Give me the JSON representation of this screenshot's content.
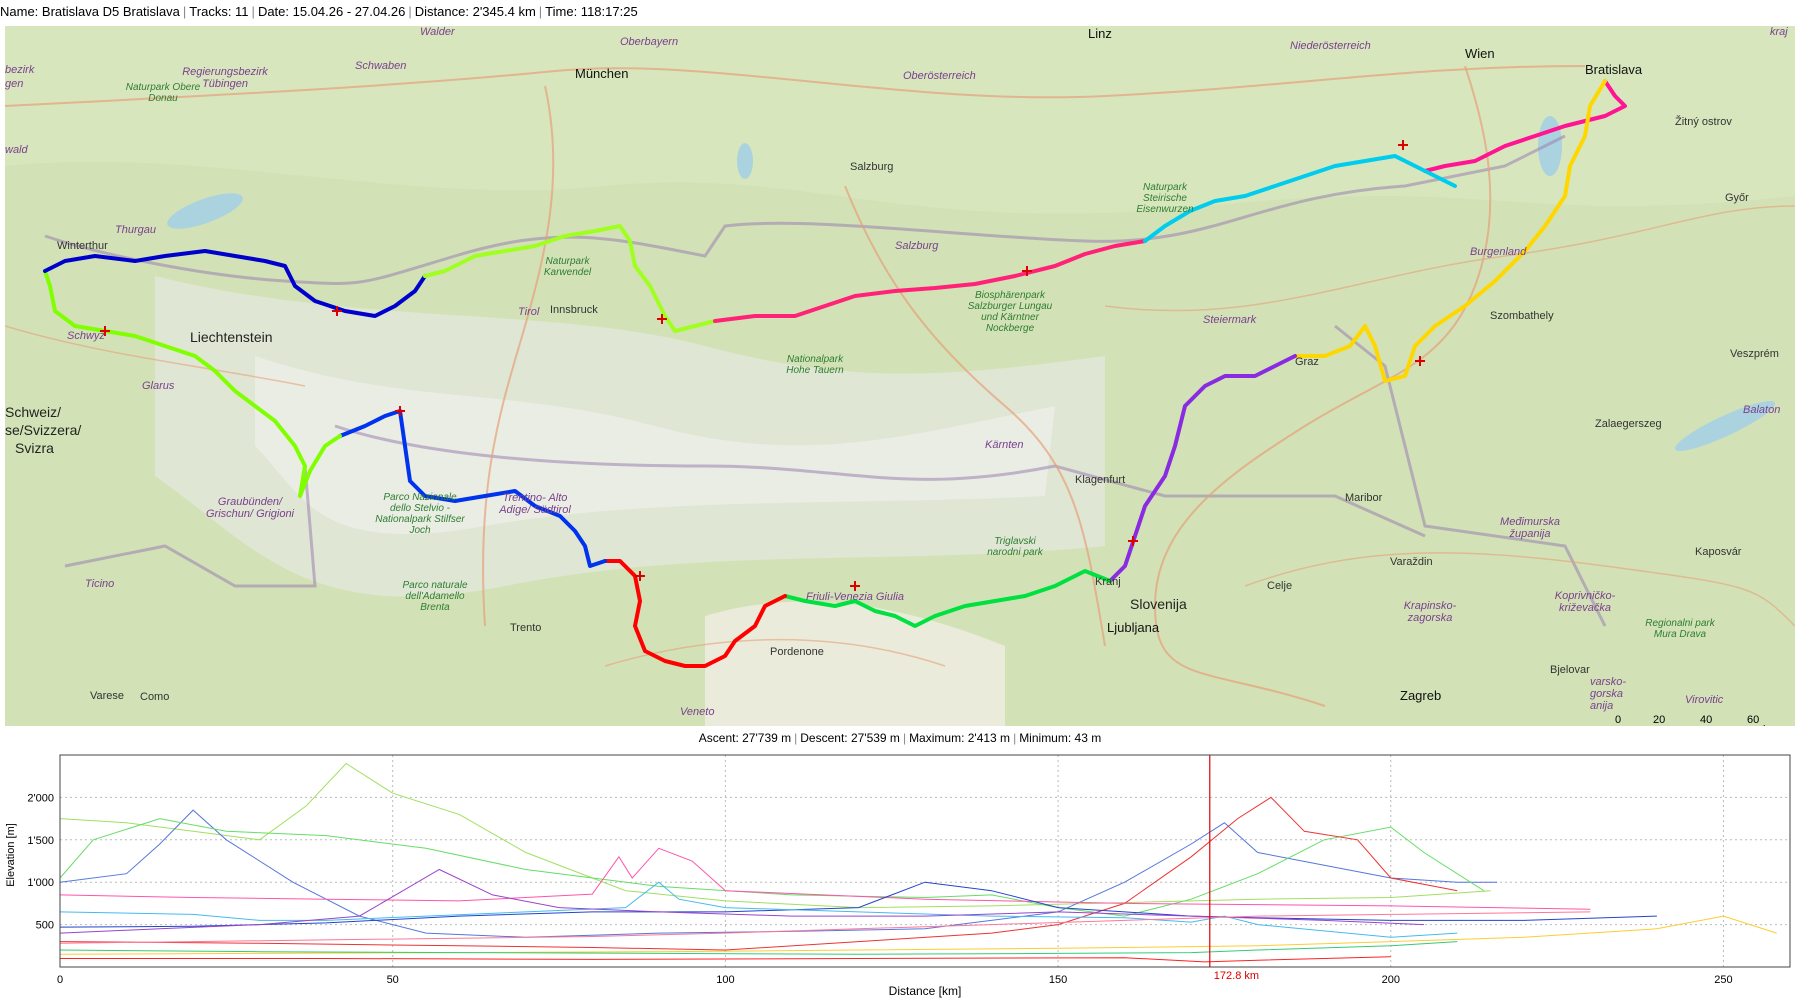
{
  "header": {
    "name": "Name: Bratislava D5 Bratislava",
    "tracks": "Tracks: 11",
    "date": "Date: 15.04.26 - 27.04.26",
    "distance": "Distance: 2'345.4 km",
    "time": "Time: 118:17:25"
  },
  "map": {
    "labels": [
      {
        "text": "München",
        "kind": "city"
      },
      {
        "text": "Wien",
        "kind": "city"
      },
      {
        "text": "Bratislava",
        "kind": "city"
      },
      {
        "text": "Salzburg",
        "kind": "city-small"
      },
      {
        "text": "Salzburg",
        "kind": "region"
      },
      {
        "text": "Linz",
        "kind": "city"
      },
      {
        "text": "Innsbruck",
        "kind": "city-small"
      },
      {
        "text": "Liechtenstein",
        "kind": "country"
      },
      {
        "text": "Winterthur",
        "kind": "city-small"
      },
      {
        "text": "Thurgau",
        "kind": "region"
      },
      {
        "text": "Schwyz",
        "kind": "region"
      },
      {
        "text": "Glarus",
        "kind": "region"
      },
      {
        "text": "Schweiz/",
        "kind": "country"
      },
      {
        "text": "se/Svizzera/",
        "kind": "country"
      },
      {
        "text": "Svizra",
        "kind": "country"
      },
      {
        "text": "Graubünden/ Grischun/ Grigioni",
        "kind": "region"
      },
      {
        "text": "Ticino",
        "kind": "region"
      },
      {
        "text": "Varese",
        "kind": "city-small"
      },
      {
        "text": "Como",
        "kind": "city-small"
      },
      {
        "text": "Trento",
        "kind": "city-small"
      },
      {
        "text": "Trentino- Alto Adige/ Südtirol",
        "kind": "region"
      },
      {
        "text": "Parco Nazionale dello Stelvio - Nationalpark Stilfser Joch",
        "kind": "park"
      },
      {
        "text": "Parco naturale dell'Adamello Brenta",
        "kind": "park"
      },
      {
        "text": "Pordenone",
        "kind": "city-small"
      },
      {
        "text": "Veneto",
        "kind": "region"
      },
      {
        "text": "Friuli-Venezia Giulia",
        "kind": "region"
      },
      {
        "text": "Triglavski narodni park",
        "kind": "park"
      },
      {
        "text": "Kranj",
        "kind": "city-small"
      },
      {
        "text": "Slovenija",
        "kind": "country"
      },
      {
        "text": "Ljubljana",
        "kind": "city"
      },
      {
        "text": "Celje",
        "kind": "city-small"
      },
      {
        "text": "Maribor",
        "kind": "city-small"
      },
      {
        "text": "Klagenfurt",
        "kind": "city-small"
      },
      {
        "text": "Kärnten",
        "kind": "region"
      },
      {
        "text": "Steiermark",
        "kind": "region"
      },
      {
        "text": "Graz",
        "kind": "city-small"
      },
      {
        "text": "Szombathely",
        "kind": "city-small"
      },
      {
        "text": "Burgenland",
        "kind": "region"
      },
      {
        "text": "Győr",
        "kind": "city-small"
      },
      {
        "text": "Veszprém",
        "kind": "city-small"
      },
      {
        "text": "Balaton",
        "kind": "region"
      },
      {
        "text": "Zalaegerszeg",
        "kind": "city-small"
      },
      {
        "text": "Kaposvár",
        "kind": "city-small"
      },
      {
        "text": "Varaždin",
        "kind": "city-small"
      },
      {
        "text": "Zagreb",
        "kind": "city"
      },
      {
        "text": "Bjelovar",
        "kind": "city-small"
      },
      {
        "text": "Krapinsko- zagorska",
        "kind": "region"
      },
      {
        "text": "Koprivničko- križevačka",
        "kind": "region"
      },
      {
        "text": "Međimurska županija",
        "kind": "region"
      },
      {
        "text": "Regionalni park Mura Drava",
        "kind": "park"
      },
      {
        "text": "Niederösterreich",
        "kind": "region"
      },
      {
        "text": "Oberösterreich",
        "kind": "region"
      },
      {
        "text": "Oberbayern",
        "kind": "region"
      },
      {
        "text": "Schwaben",
        "kind": "region"
      },
      {
        "text": "Regierungsbezirk Tübingen",
        "kind": "region"
      },
      {
        "text": "Naturpark Obere Donau",
        "kind": "park"
      },
      {
        "text": "Naturpark Karwendel",
        "kind": "park"
      },
      {
        "text": "Tirol",
        "kind": "region"
      },
      {
        "text": "Nationalpark Hohe Tauern",
        "kind": "park"
      },
      {
        "text": "Biosphärenpark Salzburger Lungau und Kärntner Nockberge",
        "kind": "park"
      },
      {
        "text": "Naturpark Steirische Eisenwurzen",
        "kind": "park"
      },
      {
        "text": "Žitný ostrov",
        "kind": "city-small"
      },
      {
        "text": "Walder",
        "kind": "region"
      },
      {
        "text": "bezirk",
        "kind": "region"
      },
      {
        "text": "gen",
        "kind": "region"
      },
      {
        "text": "wald",
        "kind": "region"
      },
      {
        "text": "kraj",
        "kind": "region"
      },
      {
        "text": "varsko- gorska anija",
        "kind": "region"
      },
      {
        "text": "Virovitic",
        "kind": "region"
      }
    ],
    "scale": {
      "ticks": [
        "0",
        "20",
        "40",
        "60"
      ],
      "unit": "km"
    },
    "track_colors": [
      "#ff1493",
      "#ffd700",
      "#8a2be2",
      "#00e040",
      "#ff0000",
      "#0033ee",
      "#7fff00",
      "#0000cc",
      "#a0ff20",
      "#ff2277",
      "#00ccee"
    ]
  },
  "stats": {
    "ascent": "Ascent: 27'739 m",
    "descent": "Descent: 27'539 m",
    "maximum": "Maximum: 2'413 m",
    "minimum": "Minimum: 43 m"
  },
  "chart_data": {
    "type": "line",
    "title": "",
    "xlabel": "Distance [km]",
    "ylabel": "Elevation [m]",
    "xlim": [
      0,
      260
    ],
    "ylim": [
      0,
      2500
    ],
    "x_ticks": [
      "0",
      "50",
      "100",
      "150",
      "200",
      "250"
    ],
    "y_ticks": [
      "500",
      "1'000",
      "1'500",
      "2'000"
    ],
    "grid": true,
    "cursor": {
      "x": 172.8,
      "label": "172.8 km",
      "color": "#dd0000"
    },
    "series": [
      {
        "color": "#a0e060",
        "points": [
          [
            0,
            1750
          ],
          [
            10,
            1700
          ],
          [
            20,
            1600
          ],
          [
            30,
            1500
          ],
          [
            37,
            1900
          ],
          [
            43,
            2400
          ],
          [
            50,
            2050
          ],
          [
            60,
            1800
          ],
          [
            70,
            1350
          ],
          [
            85,
            900
          ],
          [
            100,
            780
          ],
          [
            120,
            700
          ],
          [
            140,
            720
          ],
          [
            160,
            760
          ],
          [
            180,
            800
          ],
          [
            200,
            820
          ],
          [
            215,
            900
          ]
        ]
      },
      {
        "color": "#5577dd",
        "points": [
          [
            0,
            1000
          ],
          [
            10,
            1100
          ],
          [
            15,
            1450
          ],
          [
            20,
            1850
          ],
          [
            25,
            1500
          ],
          [
            35,
            1000
          ],
          [
            45,
            600
          ],
          [
            55,
            400
          ],
          [
            70,
            350
          ],
          [
            90,
            400
          ],
          [
            110,
            420
          ],
          [
            130,
            450
          ],
          [
            150,
            650
          ],
          [
            160,
            1000
          ],
          [
            170,
            1450
          ],
          [
            175,
            1700
          ],
          [
            180,
            1350
          ],
          [
            190,
            1200
          ],
          [
            200,
            1050
          ],
          [
            210,
            1000
          ],
          [
            216,
            1000
          ]
        ]
      },
      {
        "color": "#66dd66",
        "points": [
          [
            0,
            1050
          ],
          [
            5,
            1500
          ],
          [
            15,
            1750
          ],
          [
            25,
            1600
          ],
          [
            40,
            1550
          ],
          [
            55,
            1400
          ],
          [
            70,
            1150
          ],
          [
            90,
            950
          ],
          [
            110,
            850
          ],
          [
            130,
            820
          ],
          [
            140,
            850
          ],
          [
            150,
            700
          ],
          [
            160,
            600
          ],
          [
            170,
            800
          ],
          [
            180,
            1100
          ],
          [
            190,
            1500
          ],
          [
            200,
            1650
          ],
          [
            205,
            1350
          ],
          [
            214,
            900
          ]
        ]
      },
      {
        "color": "#ee3333",
        "points": [
          [
            0,
            300
          ],
          [
            30,
            280
          ],
          [
            60,
            250
          ],
          [
            80,
            230
          ],
          [
            100,
            200
          ],
          [
            120,
            300
          ],
          [
            140,
            400
          ],
          [
            150,
            500
          ],
          [
            160,
            750
          ],
          [
            170,
            1300
          ],
          [
            177,
            1750
          ],
          [
            182,
            2000
          ],
          [
            187,
            1600
          ],
          [
            195,
            1500
          ],
          [
            200,
            1050
          ],
          [
            210,
            900
          ]
        ]
      },
      {
        "color": "#ff55aa",
        "points": [
          [
            0,
            850
          ],
          [
            20,
            820
          ],
          [
            40,
            800
          ],
          [
            60,
            780
          ],
          [
            80,
            860
          ],
          [
            84,
            1300
          ],
          [
            86,
            1050
          ],
          [
            90,
            1400
          ],
          [
            95,
            1250
          ],
          [
            100,
            900
          ],
          [
            130,
            800
          ],
          [
            160,
            750
          ],
          [
            200,
            720
          ],
          [
            230,
            680
          ]
        ]
      },
      {
        "color": "#2244cc",
        "points": [
          [
            0,
            470
          ],
          [
            20,
            480
          ],
          [
            40,
            520
          ],
          [
            60,
            600
          ],
          [
            80,
            650
          ],
          [
            100,
            650
          ],
          [
            120,
            700
          ],
          [
            130,
            1000
          ],
          [
            140,
            900
          ],
          [
            150,
            700
          ],
          [
            160,
            650
          ],
          [
            170,
            600
          ],
          [
            180,
            580
          ],
          [
            200,
            550
          ],
          [
            220,
            550
          ],
          [
            240,
            600
          ]
        ]
      },
      {
        "color": "#44bbee",
        "points": [
          [
            0,
            650
          ],
          [
            20,
            620
          ],
          [
            30,
            550
          ],
          [
            40,
            550
          ],
          [
            55,
            600
          ],
          [
            70,
            650
          ],
          [
            85,
            700
          ],
          [
            90,
            1000
          ],
          [
            93,
            800
          ],
          [
            100,
            700
          ],
          [
            120,
            650
          ],
          [
            140,
            600
          ],
          [
            160,
            580
          ],
          [
            170,
            530
          ],
          [
            175,
            600
          ],
          [
            180,
            500
          ],
          [
            200,
            350
          ],
          [
            210,
            400
          ]
        ]
      },
      {
        "color": "#9944cc",
        "points": [
          [
            0,
            400
          ],
          [
            15,
            450
          ],
          [
            30,
            500
          ],
          [
            45,
            600
          ],
          [
            57,
            1150
          ],
          [
            65,
            850
          ],
          [
            75,
            700
          ],
          [
            90,
            650
          ],
          [
            110,
            600
          ],
          [
            130,
            600
          ],
          [
            150,
            650
          ],
          [
            170,
            600
          ],
          [
            190,
            550
          ],
          [
            205,
            500
          ]
        ]
      },
      {
        "color": "#ffcc33",
        "points": [
          [
            0,
            150
          ],
          [
            30,
            160
          ],
          [
            60,
            170
          ],
          [
            90,
            180
          ],
          [
            120,
            200
          ],
          [
            150,
            220
          ],
          [
            180,
            250
          ],
          [
            200,
            300
          ],
          [
            220,
            350
          ],
          [
            240,
            450
          ],
          [
            250,
            600
          ],
          [
            258,
            400
          ]
        ]
      },
      {
        "color": "#33cc77",
        "points": [
          [
            0,
            200
          ],
          [
            30,
            180
          ],
          [
            60,
            170
          ],
          [
            90,
            160
          ],
          [
            120,
            150
          ],
          [
            150,
            160
          ],
          [
            170,
            170
          ],
          [
            180,
            200
          ],
          [
            200,
            250
          ],
          [
            210,
            300
          ]
        ]
      },
      {
        "color": "#ff7799",
        "points": [
          [
            0,
            280
          ],
          [
            20,
            300
          ],
          [
            40,
            320
          ],
          [
            60,
            340
          ],
          [
            80,
            360
          ],
          [
            100,
            400
          ],
          [
            120,
            450
          ],
          [
            140,
            500
          ],
          [
            160,
            550
          ],
          [
            180,
            600
          ],
          [
            200,
            620
          ],
          [
            230,
            650
          ]
        ]
      },
      {
        "color": "#ff2222",
        "points": [
          [
            0,
            100
          ],
          [
            40,
            100
          ],
          [
            80,
            90
          ],
          [
            120,
            100
          ],
          [
            160,
            110
          ],
          [
            172,
            60
          ],
          [
            180,
            80
          ],
          [
            200,
            120
          ]
        ]
      }
    ]
  }
}
